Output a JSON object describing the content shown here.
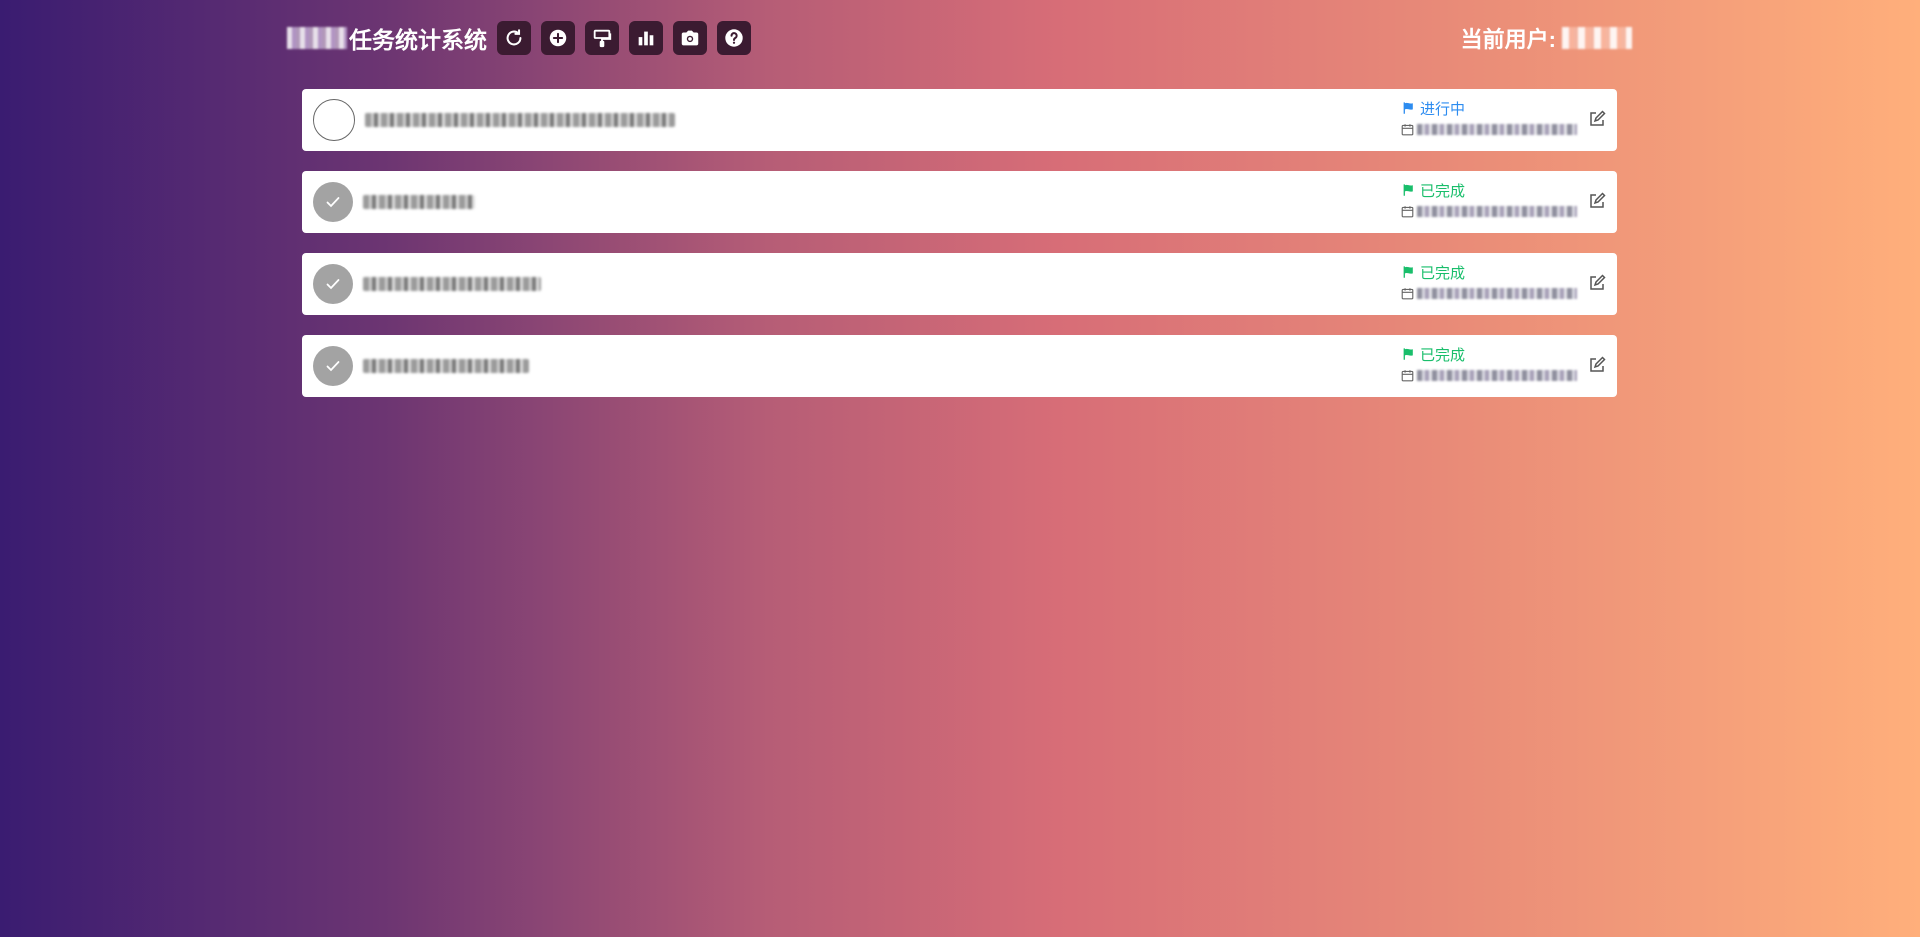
{
  "header": {
    "title": "任务统计系统",
    "user_label": "当前用户:",
    "toolbar": [
      {
        "name": "refresh-button",
        "icon": "refresh-icon"
      },
      {
        "name": "add-task-button",
        "icon": "plus-circle-icon"
      },
      {
        "name": "paint-button",
        "icon": "paint-roller-icon"
      },
      {
        "name": "statistics-button",
        "icon": "bar-chart-icon"
      },
      {
        "name": "screenshot-button",
        "icon": "camera-icon"
      },
      {
        "name": "help-button",
        "icon": "question-circle-icon"
      }
    ]
  },
  "tasks": [
    {
      "status": "进行中",
      "state": "in-progress",
      "text_width": 310
    },
    {
      "status": "已完成",
      "state": "completed",
      "text_width": 112
    },
    {
      "status": "已完成",
      "state": "completed",
      "text_width": 178
    },
    {
      "status": "已完成",
      "state": "completed",
      "text_width": 166
    }
  ],
  "colors": {
    "in_progress": "#2d8cf0",
    "completed": "#19be6b",
    "toolbar_button": "#3b1b31",
    "gradient_start": "#3a1c71",
    "gradient_mid": "#d76d77",
    "gradient_end": "#ffaf7b"
  }
}
